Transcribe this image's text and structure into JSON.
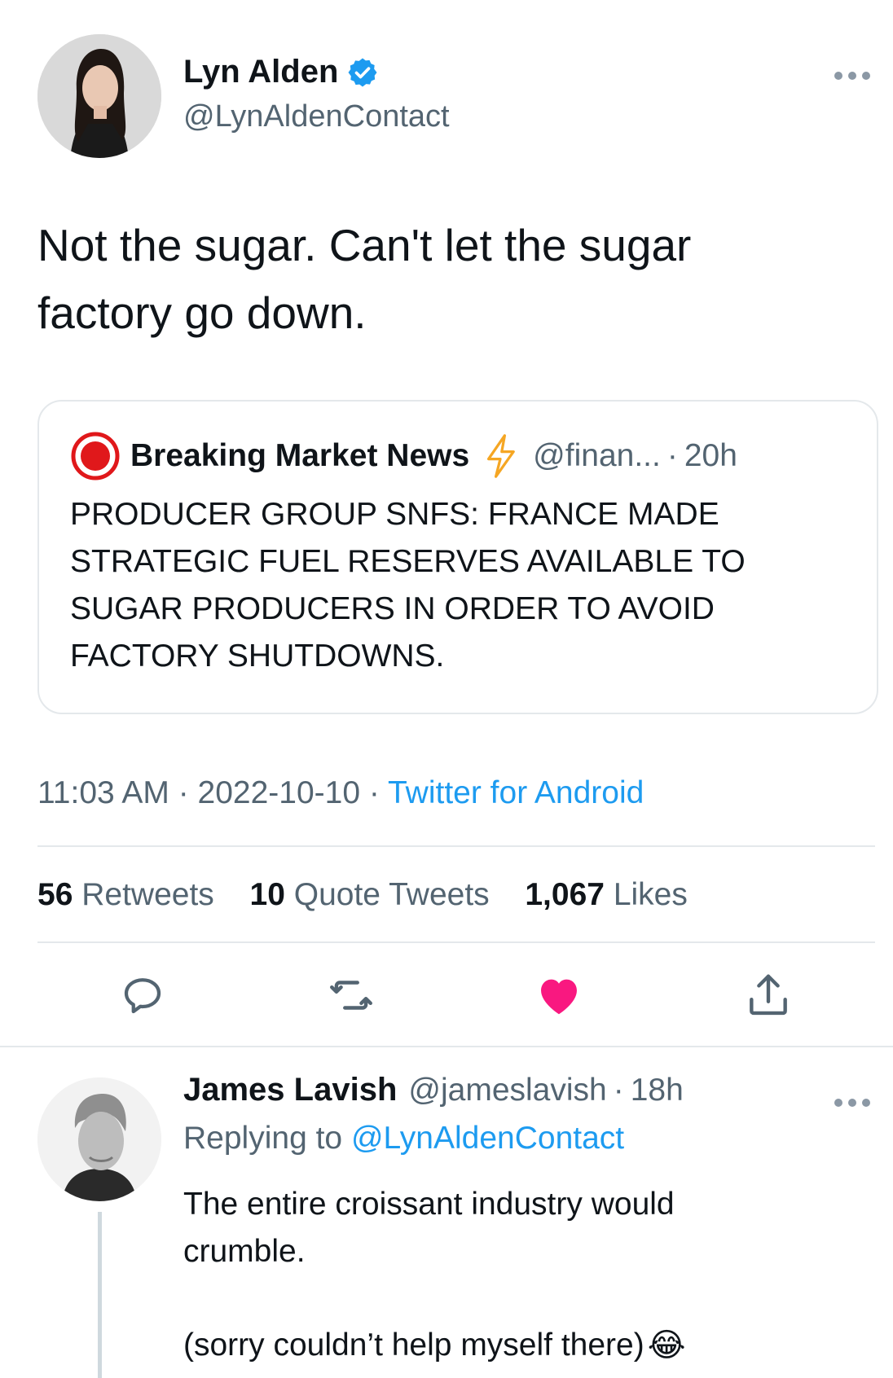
{
  "tweet": {
    "author_name": "Lyn Alden",
    "author_handle": "@LynAldenContact",
    "text_line1": "Not the sugar. Can't let the sugar",
    "text_line2": "factory go down.",
    "quote": {
      "name": "Breaking Market News",
      "handle": "@finan...",
      "sep": "·",
      "time": "20h",
      "lines": [
        "PRODUCER GROUP SNFS: FRANCE MADE",
        "STRATEGIC FUEL RESERVES AVAILABLE TO",
        "SUGAR PRODUCERS IN ORDER TO AVOID",
        "FACTORY SHUTDOWNS."
      ]
    },
    "timestamp": "11:03 AM · 2022-10-10 · ",
    "source": "Twitter for Android",
    "stats": {
      "retweets_count": "56",
      "retweets_label": "Retweets",
      "quotes_count": "10",
      "quotes_label": "Quote Tweets",
      "likes_count": "1,067",
      "likes_label": "Likes"
    },
    "colors": {
      "like": "#f91880",
      "link": "#1d9bf0",
      "verified": "#1d9bf0",
      "breaking": "#e0181b",
      "bolt": "#f5a623"
    }
  },
  "reply": {
    "name": "James Lavish",
    "handle": "@jameslavish",
    "sep": "·",
    "time": "18h",
    "replying_prefix": "Replying to ",
    "replying_handle": "@LynAldenContact",
    "line1": "The entire croissant industry would",
    "line2": "crumble.",
    "line3": "(sorry couldn’t help myself there)",
    "emoji": "😂"
  }
}
